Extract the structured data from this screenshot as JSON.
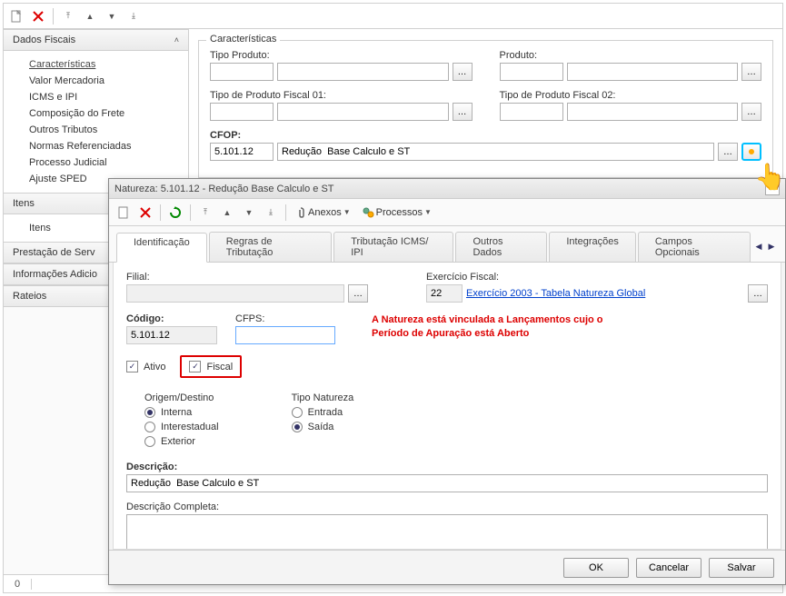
{
  "main_toolbar": {
    "new_icon": "new-doc",
    "close_icon": "close-red",
    "nav_first": "⊼",
    "nav_prev": "▲",
    "nav_next": "▼",
    "nav_last": "⊻"
  },
  "sidebar": {
    "sections": [
      {
        "title": "Dados Fiscais",
        "expanded": true,
        "items": [
          "Características",
          "Valor Mercadoria",
          "ICMS e IPI",
          "Composição do Frete",
          "Outros Tributos",
          "Normas Referenciadas",
          "Processo Judicial",
          "Ajuste SPED"
        ],
        "active_index": 0
      },
      {
        "title": "Itens",
        "expanded": true,
        "items": [
          "Itens"
        ]
      },
      {
        "title": "Prestação de Serv",
        "expanded": false,
        "items": []
      },
      {
        "title": "Informações Adicio",
        "expanded": false,
        "items": []
      },
      {
        "title": "Rateios",
        "expanded": false,
        "items": []
      }
    ]
  },
  "main_panel": {
    "fieldset_title": "Características",
    "tipo_produto_label": "Tipo Produto:",
    "tipo_produto_code": "",
    "tipo_produto_desc": "",
    "produto_label": "Produto:",
    "produto_code": "",
    "produto_desc": "",
    "tpf1_label": "Tipo de Produto Fiscal 01:",
    "tpf1_code": "",
    "tpf1_desc": "",
    "tpf2_label": "Tipo de Produto Fiscal 02:",
    "tpf2_code": "",
    "tpf2_desc": "",
    "cfop_label": "CFOP:",
    "cfop_code": "5.101.12",
    "cfop_desc": "Redução  Base Calculo e ST"
  },
  "status_bar": {
    "count": "0"
  },
  "dialog": {
    "title": "Natureza: 5.101.12 - Redução  Base Calculo e ST",
    "toolbar": {
      "anexos_label": "Anexos",
      "processos_label": "Processos"
    },
    "tabs": [
      "Identificação",
      "Regras de Tributação",
      "Tributação ICMS/ IPI",
      "Outros Dados",
      "Integrações",
      "Campos Opcionais"
    ],
    "active_tab": 0,
    "content": {
      "filial_label": "Filial:",
      "filial_value": "",
      "exercicio_label": "Exercício Fiscal:",
      "exercicio_code": "22",
      "exercicio_link": "Exercício 2003 - Tabela Natureza Global",
      "codigo_label": "Código:",
      "codigo_value": "5.101.12",
      "cfps_label": "CFPS:",
      "cfps_value": "",
      "warning_line1": "A Natureza está vinculada a Lançamentos cujo o",
      "warning_line2": "Período de Apuração está Aberto",
      "ativo_label": "Ativo",
      "ativo_checked": true,
      "fiscal_label": "Fiscal",
      "fiscal_checked": true,
      "origem_title": "Origem/Destino",
      "origem_options": [
        {
          "label": "Interna",
          "checked": true
        },
        {
          "label": "Interestadual",
          "checked": false
        },
        {
          "label": "Exterior",
          "checked": false
        }
      ],
      "tipo_nat_title": "Tipo Natureza",
      "tipo_nat_options": [
        {
          "label": "Entrada",
          "checked": false
        },
        {
          "label": "Saída",
          "checked": true
        }
      ],
      "descricao_label": "Descrição:",
      "descricao_value": "Redução  Base Calculo e ST",
      "desc_completa_label": "Descrição Completa:",
      "desc_completa_value": ""
    },
    "buttons": {
      "ok": "OK",
      "cancel": "Cancelar",
      "save": "Salvar"
    }
  }
}
